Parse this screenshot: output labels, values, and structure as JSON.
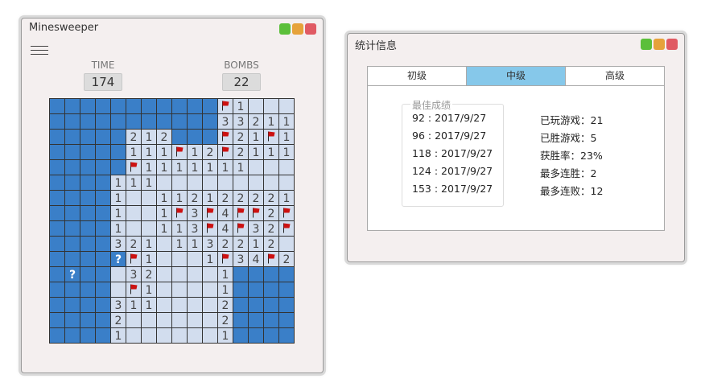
{
  "minesweeper": {
    "title": "Minesweeper",
    "time_label": "TIME",
    "time_value": "174",
    "bombs_label": "BOMBS",
    "bombs_value": "22",
    "board": {
      "rows": 16,
      "cols": 16,
      "cells": [
        "UUUUUUUUUUUF1OOO",
        "UUUUUUUUUUU33211",
        "UUUUU212UUUF21F1",
        "UUUUU111F12F2111",
        "UUUUUF1111111OOO",
        "UUUU111OOOOOOOOO",
        "UUUU1OO1121222211",
        "UUUU1OO1F3F4FF2F2",
        "UUUU1OO113F4F32F",
        "UUUU321O1132212 2",
        "UUUU?F1OOO1F34F2",
        "U?UUO32OOOO1UUUU",
        "UUUUOF1OOOO1UUUU",
        "UUUU311OOOO2UUUU",
        "UUUU2OOOOOO2UUUU",
        "UUUU1OOOOOO1UUUU"
      ]
    }
  },
  "stats": {
    "title": "统计信息",
    "tabs": [
      {
        "label": "初级",
        "active": false
      },
      {
        "label": "中级",
        "active": true
      },
      {
        "label": "高级",
        "active": false
      }
    ],
    "best_label": "最佳成绩",
    "best_scores": [
      "92 : 2017/9/27",
      "96 : 2017/9/27",
      "118 : 2017/9/27",
      "124 : 2017/9/27",
      "153 : 2017/9/27"
    ],
    "summary": [
      "已玩游戏：21",
      "已胜游戏：5",
      "获胜率：23%",
      "最多连胜：2",
      "最多连败：12"
    ]
  },
  "colors": {
    "unrevealed": "#3a7fc8",
    "revealed": "#d2ddee",
    "flag": "#cc1111",
    "grid_line": "#333333",
    "number": "#444444"
  }
}
